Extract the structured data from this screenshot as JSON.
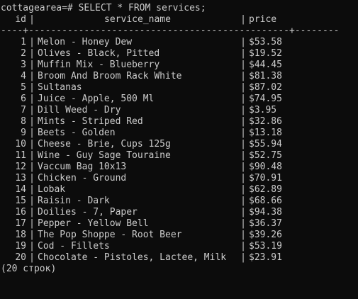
{
  "prompt": "cottagearea=# SELECT * FROM services;",
  "columns": {
    "id": "id",
    "service_name": "service_name",
    "price": "price"
  },
  "rule_line": "----+-----------------------------------------------+--------",
  "rows": [
    {
      "id": "1",
      "service_name": "Melon - Honey Dew",
      "price": "$53.58"
    },
    {
      "id": "2",
      "service_name": "Olives - Black, Pitted",
      "price": "$19.52"
    },
    {
      "id": "3",
      "service_name": "Muffin Mix - Blueberry",
      "price": "$44.45"
    },
    {
      "id": "4",
      "service_name": "Broom And Broom Rack White",
      "price": "$81.38"
    },
    {
      "id": "5",
      "service_name": "Sultanas",
      "price": "$87.02"
    },
    {
      "id": "6",
      "service_name": "Juice - Apple, 500 Ml",
      "price": "$74.95"
    },
    {
      "id": "7",
      "service_name": "Dill Weed - Dry",
      "price": "$3.95"
    },
    {
      "id": "8",
      "service_name": "Mints - Striped Red",
      "price": "$32.86"
    },
    {
      "id": "9",
      "service_name": "Beets - Golden",
      "price": "$13.18"
    },
    {
      "id": "10",
      "service_name": "Cheese - Brie, Cups 125g",
      "price": "$55.94"
    },
    {
      "id": "11",
      "service_name": "Wine - Guy Sage Touraine",
      "price": "$52.75"
    },
    {
      "id": "12",
      "service_name": "Vaccum Bag 10x13",
      "price": "$90.48"
    },
    {
      "id": "13",
      "service_name": "Chicken - Ground",
      "price": "$70.91"
    },
    {
      "id": "14",
      "service_name": "Lobak",
      "price": "$62.89"
    },
    {
      "id": "15",
      "service_name": "Raisin - Dark",
      "price": "$68.66"
    },
    {
      "id": "16",
      "service_name": "Doilies - 7, Paper",
      "price": "$94.38"
    },
    {
      "id": "17",
      "service_name": "Pepper - Yellow Bell",
      "price": "$36.37"
    },
    {
      "id": "18",
      "service_name": "The Pop Shoppe - Root Beer",
      "price": "$39.26"
    },
    {
      "id": "19",
      "service_name": "Cod - Fillets",
      "price": "$53.19"
    },
    {
      "id": "20",
      "service_name": "Chocolate - Pistoles, Lactee, Milk",
      "price": "$23.91"
    }
  ],
  "footer": "(20 строк)",
  "colors": {
    "background": "#0c0c0c",
    "text": "#cccccc"
  }
}
